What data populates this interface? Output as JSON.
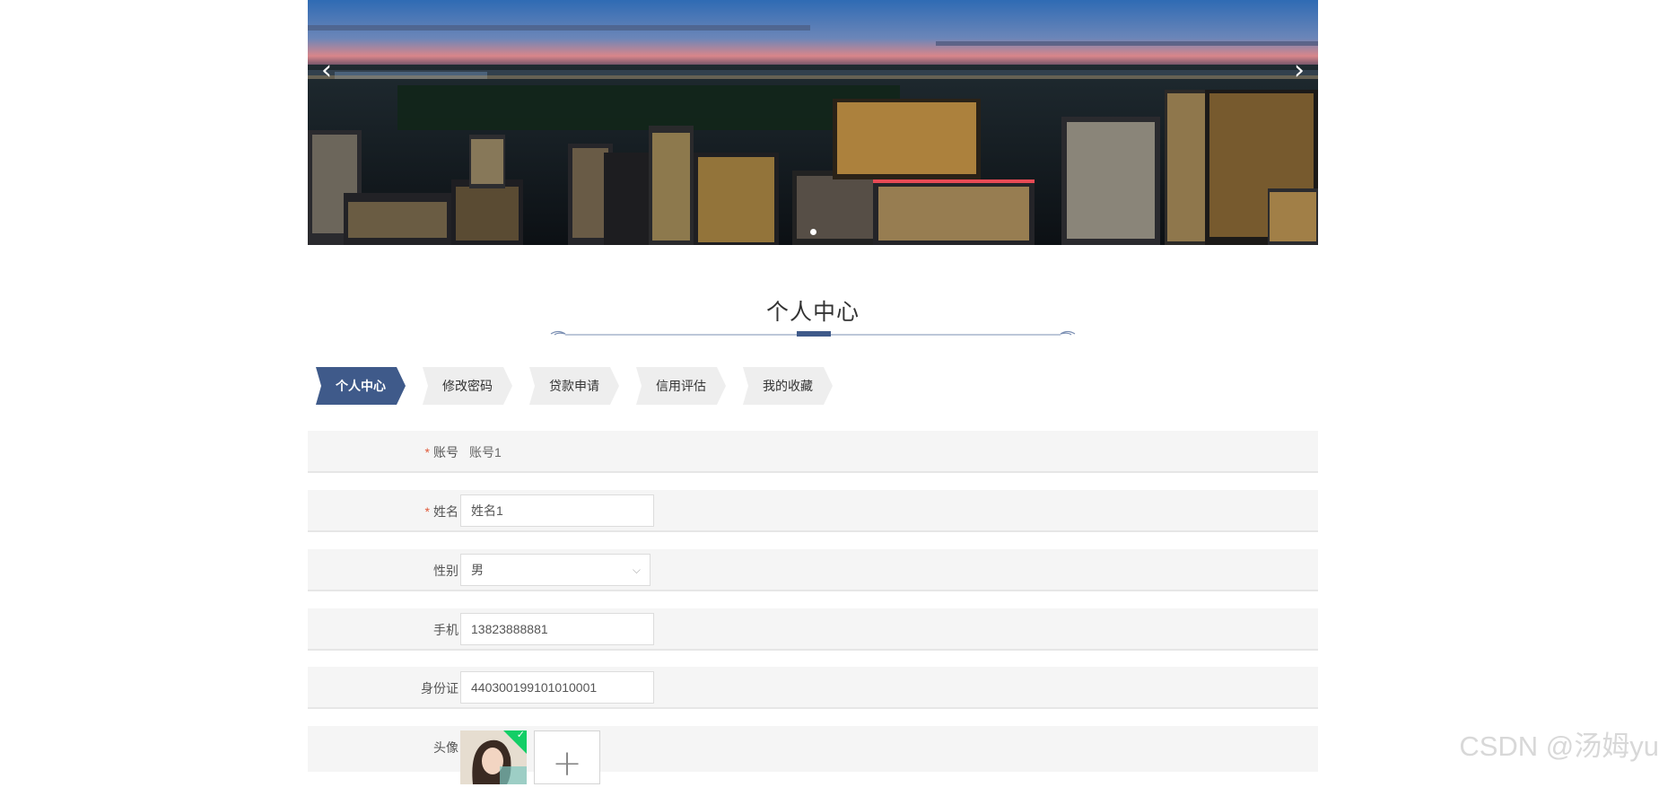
{
  "banner": {
    "prev_glyph": "‹",
    "next_glyph": "›",
    "prev_icon": "chevron-left-icon",
    "next_icon": "chevron-right-icon",
    "slide_count": 1
  },
  "section": {
    "title": "个人中心"
  },
  "tabs": [
    {
      "label": "个人中心",
      "active": true
    },
    {
      "label": "修改密码",
      "active": false
    },
    {
      "label": "贷款申请",
      "active": false
    },
    {
      "label": "信用评估",
      "active": false
    },
    {
      "label": "我的收藏",
      "active": false
    }
  ],
  "form": {
    "account": {
      "label": "账号",
      "value": "账号1",
      "required": "*"
    },
    "name": {
      "label": "姓名",
      "value": "姓名1",
      "required": "*"
    },
    "gender": {
      "label": "性别",
      "value": "男",
      "icon": "chevron-down-icon",
      "chevron": "⌵"
    },
    "phone": {
      "label": "手机",
      "value": "13823888881"
    },
    "idcard": {
      "label": "身份证",
      "value": "440300199101010001"
    },
    "avatar": {
      "label": "头像",
      "upload_glyph": "+",
      "upload_icon": "plus-icon",
      "check_glyph": "✓"
    }
  },
  "watermark": {
    "text": "CSDN @汤姆yu"
  },
  "colors": {
    "accent": "#3f5a8a",
    "required": "#e05a3a",
    "success": "#13ce66"
  }
}
